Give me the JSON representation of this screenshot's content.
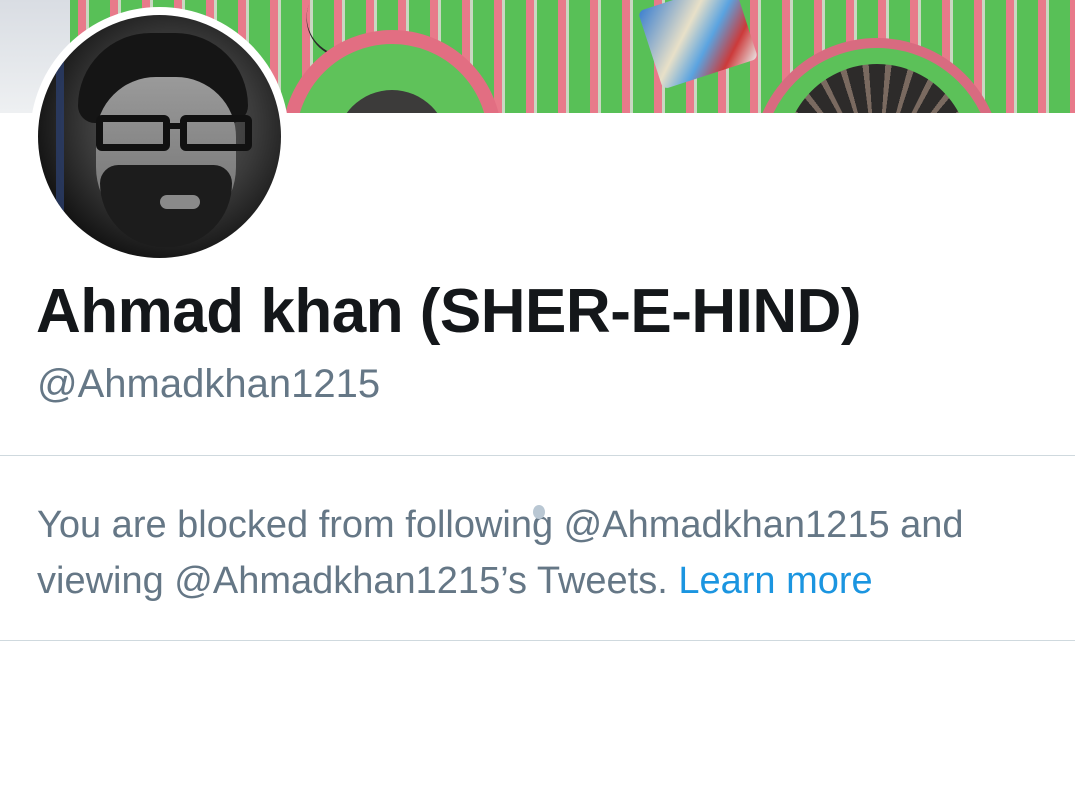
{
  "profile": {
    "display_name": "Ahmad khan (SHER-E-HIND)",
    "handle": "@Ahmadkhan1215"
  },
  "blocked_notice": {
    "message": "You are blocked from following @Ahmadkhan1215 and viewing @Ahmadkhan1215’s Tweets.",
    "link_label": "Learn more"
  },
  "colors": {
    "name_text": "#14171a",
    "secondary_text": "#657786",
    "link": "#1b95e0",
    "divider": "#cfd9de"
  },
  "icons": {
    "avatar": "profile-photo",
    "banner": "header-photo"
  }
}
